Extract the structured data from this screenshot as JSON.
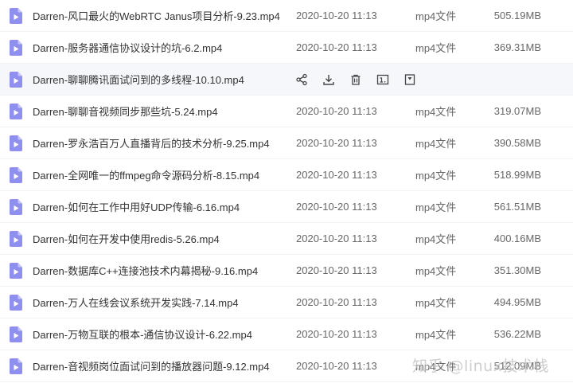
{
  "files": [
    {
      "name": "Darren-风口最火的WebRTC Janus项目分析-9.23.mp4",
      "date": "2020-10-20 11:13",
      "type": "mp4文件",
      "size": "505.19MB"
    },
    {
      "name": "Darren-服务器通信协议设计的坑-6.2.mp4",
      "date": "2020-10-20 11:13",
      "type": "mp4文件",
      "size": "369.31MB"
    },
    {
      "name": "Darren-聊聊腾讯面试问到的多线程-10.10.mp4",
      "date": "",
      "type": "",
      "size": ""
    },
    {
      "name": "Darren-聊聊音视频同步那些坑-5.24.mp4",
      "date": "2020-10-20 11:13",
      "type": "mp4文件",
      "size": "319.07MB"
    },
    {
      "name": "Darren-罗永浩百万人直播背后的技术分析-9.25.mp4",
      "date": "2020-10-20 11:13",
      "type": "mp4文件",
      "size": "390.58MB"
    },
    {
      "name": "Darren-全网唯一的ffmpeg命令源码分析-8.15.mp4",
      "date": "2020-10-20 11:13",
      "type": "mp4文件",
      "size": "518.99MB"
    },
    {
      "name": "Darren-如何在工作中用好UDP传输-6.16.mp4",
      "date": "2020-10-20 11:13",
      "type": "mp4文件",
      "size": "561.51MB"
    },
    {
      "name": "Darren-如何在开发中使用redis-5.26.mp4",
      "date": "2020-10-20 11:13",
      "type": "mp4文件",
      "size": "400.16MB"
    },
    {
      "name": "Darren-数据库C++连接池技术内幕揭秘-9.16.mp4",
      "date": "2020-10-20 11:13",
      "type": "mp4文件",
      "size": "351.30MB"
    },
    {
      "name": "Darren-万人在线会议系统开发实践-7.14.mp4",
      "date": "2020-10-20 11:13",
      "type": "mp4文件",
      "size": "494.95MB"
    },
    {
      "name": "Darren-万物互联的根本-通信协议设计-6.22.mp4",
      "date": "2020-10-20 11:13",
      "type": "mp4文件",
      "size": "536.22MB"
    },
    {
      "name": "Darren-音视频岗位面试问到的播放器问题-9.12.mp4",
      "date": "2020-10-20 11:13",
      "type": "mp4文件",
      "size": "512.09MB"
    }
  ],
  "hover_row_index": 2,
  "hover_actions": [
    "share-icon",
    "download-icon",
    "delete-icon",
    "rename-icon",
    "more-icon"
  ],
  "watermark": "知乎 @linux技术栈",
  "colors": {
    "file_icon": "#8f8ff0",
    "hover_bg": "#f5f7fa"
  }
}
